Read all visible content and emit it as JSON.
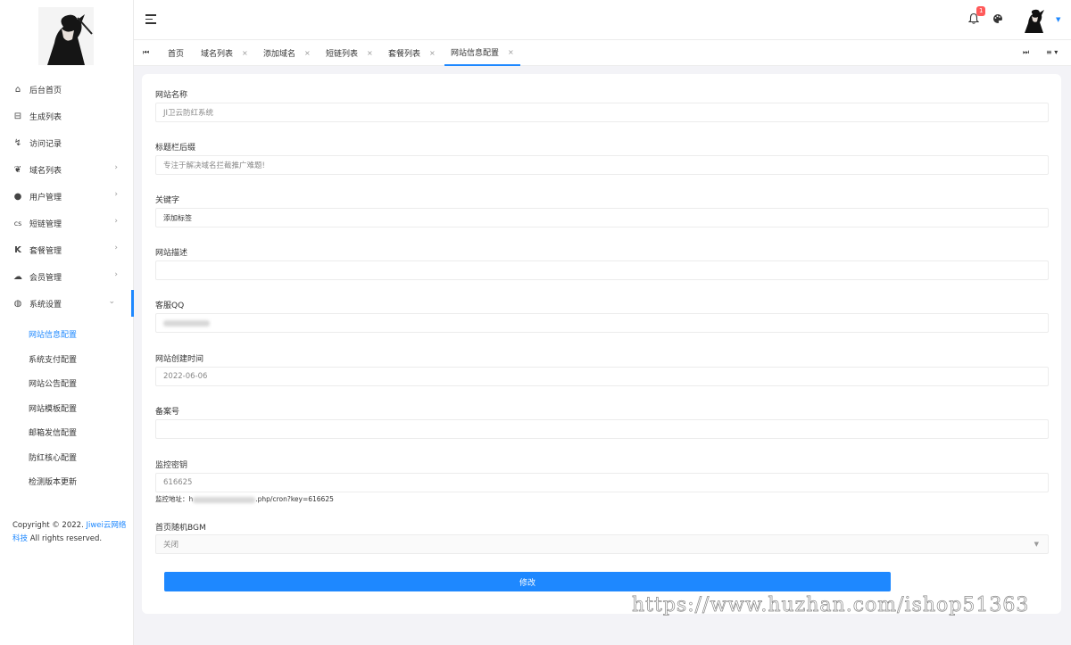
{
  "sidebar": {
    "items": [
      {
        "label": "后台首页",
        "icon": "home-icon",
        "glyph": "⌂"
      },
      {
        "label": "生成列表",
        "icon": "list-icon",
        "glyph": "⊟"
      },
      {
        "label": "访问记录",
        "icon": "record-icon",
        "glyph": "↯"
      },
      {
        "label": "域名列表",
        "icon": "leaf-icon",
        "glyph": "❦",
        "arrow": "›"
      },
      {
        "label": "用户管理",
        "icon": "user-icon",
        "glyph": "●",
        "arrow": "›"
      },
      {
        "label": "短链管理",
        "icon": "link-icon",
        "glyph": "cs",
        "arrow": "›"
      },
      {
        "label": "套餐管理",
        "icon": "k-icon",
        "glyph": "K",
        "arrow": "›"
      },
      {
        "label": "会员管理",
        "icon": "cloud-icon",
        "glyph": "☁",
        "arrow": "›"
      },
      {
        "label": "系统设置",
        "icon": "globe-icon",
        "glyph": "◍",
        "arrow": "⌄"
      }
    ],
    "sub_items": [
      "网站信息配置",
      "系统支付配置",
      "网站公告配置",
      "网站模板配置",
      "邮箱发信配置",
      "防红核心配置",
      "检测版本更新"
    ],
    "copyright_prefix": "Copyright © 2022. ",
    "copyright_link": "Jiwei云网络科技",
    "copyright_suffix": " All rights reserved."
  },
  "header": {
    "notification_count": "1"
  },
  "tabs": [
    {
      "label": "首页"
    },
    {
      "label": "域名列表",
      "close": "×"
    },
    {
      "label": "添加域名",
      "close": "×"
    },
    {
      "label": "短链列表",
      "close": "×"
    },
    {
      "label": "套餐列表",
      "close": "×"
    },
    {
      "label": "网站信息配置",
      "close": "×"
    }
  ],
  "tab_controls": {
    "prev": "⏮",
    "next": "⏭",
    "menu": "≡ ▾"
  },
  "form": {
    "fields": [
      {
        "label": "网站名称",
        "value": "JI卫云防红系统"
      },
      {
        "label": "标题栏后缀",
        "value": "专注于解决域名拦截推广难题!"
      },
      {
        "label": "关键字",
        "value": "添加标签"
      },
      {
        "label": "网站描述",
        "value": ""
      },
      {
        "label": "客服QQ",
        "value": ""
      },
      {
        "label": "网站创建时间",
        "value": "2022-06-06"
      },
      {
        "label": "备案号",
        "value": ""
      },
      {
        "label": "监控密钥",
        "value": "616625"
      },
      {
        "label": "首页随机BGM",
        "value": "关闭"
      }
    ],
    "monitor_help_prefix": "监控地址：h",
    "monitor_help_suffix": ".php/cron?key=616625",
    "submit_label": "修改"
  },
  "watermark": "https://www.huzhan.com/ishop51363",
  "colors": {
    "accent": "#1e88ff",
    "badge": "#ff5a5a"
  }
}
